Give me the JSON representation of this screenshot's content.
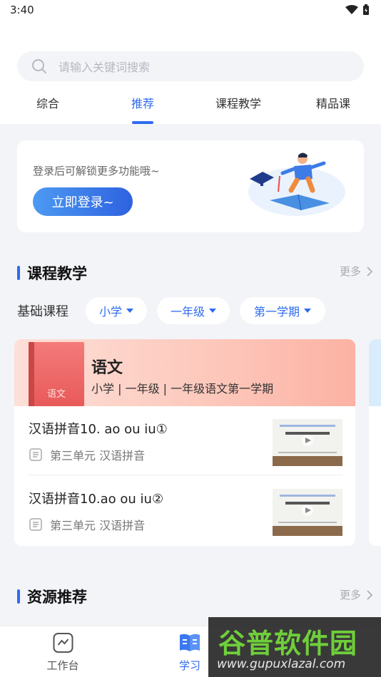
{
  "status": {
    "time": "3:40"
  },
  "search": {
    "placeholder": "请输入关键词搜索"
  },
  "tabs": [
    {
      "label": "综合",
      "active": false
    },
    {
      "label": "推荐",
      "active": true
    },
    {
      "label": "课程教学",
      "active": false
    },
    {
      "label": "精品课",
      "active": false
    }
  ],
  "login_card": {
    "hint": "登录后可解锁更多功能哦~",
    "button": "立即登录~"
  },
  "course_section": {
    "title": "课程教学",
    "more": "更多"
  },
  "filters": {
    "label": "基础课程",
    "stage": "小学",
    "grade": "一年级",
    "term": "第一学期"
  },
  "course": {
    "title": "语文",
    "subtitle": "小学 | 一年级 | 一年级语文第一学期",
    "cover_text": "语文",
    "lessons": [
      {
        "title": "汉语拼音10. ao ou iu①",
        "unit": "第三单元 汉语拼音"
      },
      {
        "title": "汉语拼音10.ao ou iu②",
        "unit": "第三单元 汉语拼音"
      }
    ]
  },
  "resource_section": {
    "title": "资源推荐",
    "more": "更多"
  },
  "bottom_nav": [
    {
      "label": "工作台",
      "icon": "workbench-icon",
      "active": false
    },
    {
      "label": "学习",
      "icon": "study-icon",
      "active": true
    }
  ],
  "watermark": {
    "text": "谷普软件园",
    "url": "www.gupuxlazal.com"
  },
  "colors": {
    "accent": "#2f6bf0",
    "watermark_green": "#6fcf3a"
  }
}
